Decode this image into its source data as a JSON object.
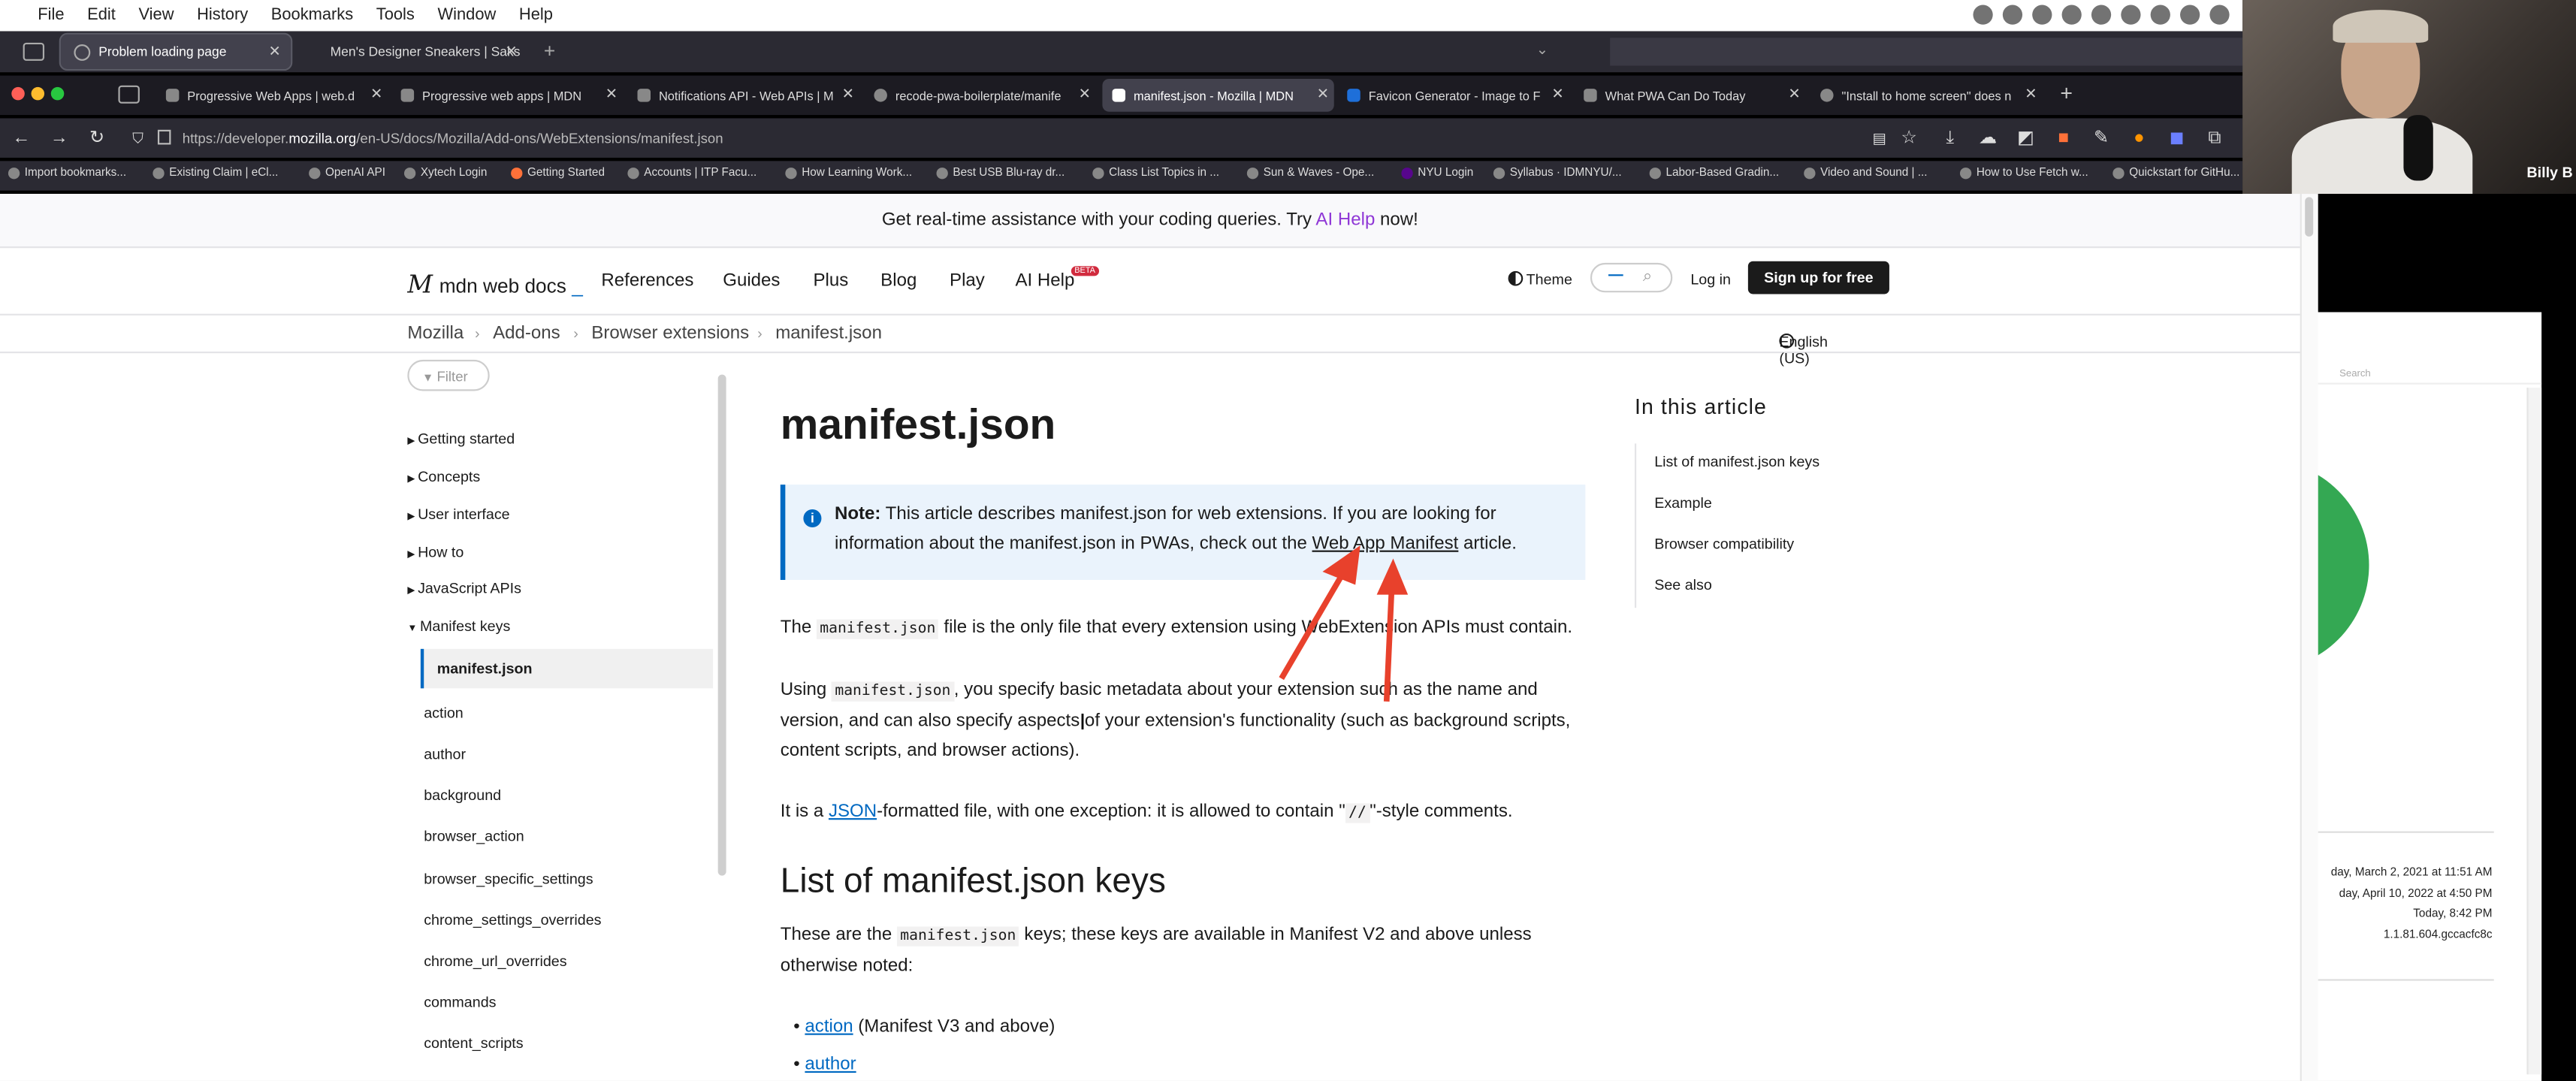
{
  "menubar": {
    "items": [
      "File",
      "Edit",
      "View",
      "History",
      "Bookmarks",
      "Tools",
      "Window",
      "Help"
    ]
  },
  "window1_tabs": [
    {
      "label": "Problem loading page"
    },
    {
      "label": "Men's Designer Sneakers | Saks"
    }
  ],
  "tabs": [
    {
      "label": "Progressive Web Apps | web.d"
    },
    {
      "label": "Progressive web apps | MDN"
    },
    {
      "label": "Notifications API - Web APIs | M"
    },
    {
      "label": "recode-pwa-boilerplate/manife"
    },
    {
      "label": "manifest.json - Mozilla | MDN"
    },
    {
      "label": "Favicon Generator - Image to F"
    },
    {
      "label": "What PWA Can Do Today"
    },
    {
      "label": "\"Install to home screen\" does n"
    }
  ],
  "url": {
    "pre": "https://developer.",
    "host": "mozilla.org",
    "path": "/en-US/docs/Mozilla/Add-ons/WebExtensions/manifest.json"
  },
  "bookmarks": [
    "Import bookmarks...",
    "Existing Claim | eCl...",
    "OpenAI API",
    "Xytech Login",
    "Getting Started",
    "Accounts | ITP Facu...",
    "How Learning Work...",
    "Best USB Blu-ray dr...",
    "Class List Topics in ...",
    "Sun & Waves - Ope...",
    "NYU Login",
    "Syllabus · IDMNYU/...",
    "Labor-Based Gradin...",
    "Video and Sound | ...",
    "How to Use Fetch w...",
    "Quickstart for GitHu..."
  ],
  "webcam": {
    "name": "Billy B"
  },
  "banner": {
    "text": "Get real-time assistance with your coding queries. Try ",
    "link": "AI Help",
    "suffix": " now!"
  },
  "header": {
    "logo": "mdn web docs",
    "logo_cursor": "_",
    "nav": [
      "References",
      "Guides",
      "Plus",
      "Blog",
      "Play",
      "AI Help"
    ],
    "beta": "BETA",
    "theme": "Theme",
    "login": "Log in",
    "signup": "Sign up for free"
  },
  "breadcrumb": [
    "Mozilla",
    "Add-ons",
    "Browser extensions",
    "manifest.json"
  ],
  "language": "English (US)",
  "sidebar": {
    "filter_placeholder": "Filter",
    "groups": [
      "Getting started",
      "Concepts",
      "User interface",
      "How to",
      "JavaScript APIs",
      "Manifest keys"
    ],
    "current": "manifest.json",
    "items": [
      "action",
      "author",
      "background",
      "browser_action",
      "browser_specific_settings",
      "chrome_settings_overrides",
      "chrome_url_overrides",
      "commands",
      "content_scripts"
    ]
  },
  "article": {
    "title": "manifest.json",
    "note_label": "Note:",
    "note_text_1": " This article describes manifest.json for web extensions. If you are looking for information about the manifest.json in PWAs, check out the ",
    "note_link": "Web App Manifest",
    "note_text_2": " article.",
    "p1_a": "The ",
    "p1_code": "manifest.json",
    "p1_b": " file is the only file that every extension using WebExtension APIs must contain.",
    "p2_a": "Using ",
    "p2_code": "manifest.json",
    "p2_b": ", you specify basic metadata about your extension such as the name and version, and can also specify aspects of your extension's functionality (such as background scripts, content scripts, and browser actions).",
    "p3_a": "It is a ",
    "p3_link": "JSON",
    "p3_b": "-formatted file, with one exception: it is allowed to contain \"",
    "p3_code": "//",
    "p3_c": "\"-style comments.",
    "h2": "List of manifest.json keys",
    "p4_a": "These are the ",
    "p4_code": "manifest.json",
    "p4_b": " keys; these keys are available in Manifest V2 and above unless otherwise noted:",
    "li1_link": "action",
    "li1_text": " (Manifest V3 and above)",
    "li2_link": "author"
  },
  "toc": {
    "heading": "In this article",
    "items": [
      "List of manifest.json keys",
      "Example",
      "Browser compatibility",
      "See also"
    ]
  },
  "right_app": {
    "search": "Search",
    "dates": [
      "day, March 2, 2021 at 11:51 AM",
      "day, April 10, 2022 at 4:50 PM",
      "Today, 8:42 PM",
      "1.1.81.604.gccacfc8c"
    ]
  },
  "colors": {
    "mdn_blue": "#0069c2",
    "arrow_red": "#e8412c",
    "ai_purple": "#8f37d6"
  }
}
